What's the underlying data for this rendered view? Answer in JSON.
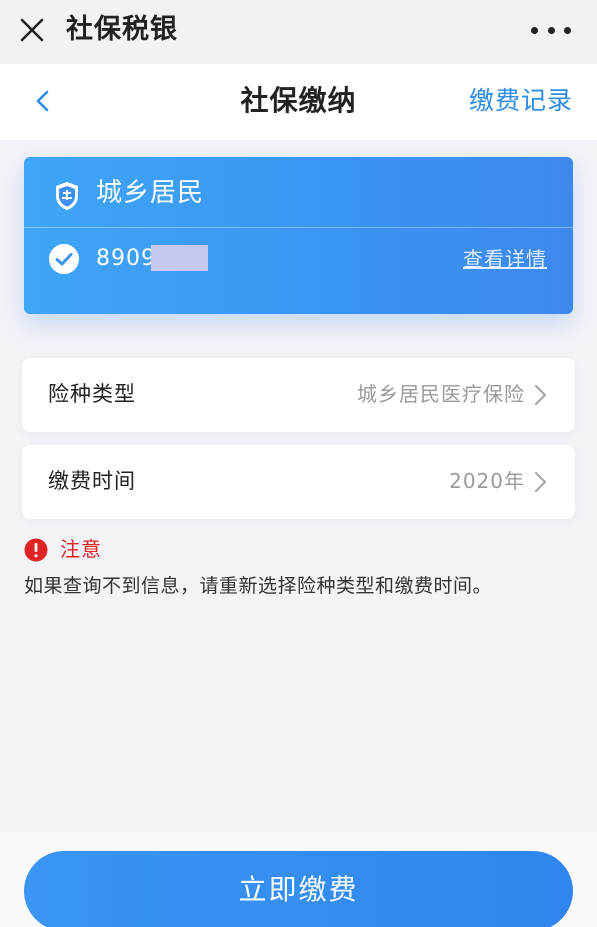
{
  "topbar": {
    "app_title": "社保税银",
    "close_icon": "close-icon",
    "more_icon": "more-icon"
  },
  "navbar": {
    "title": "社保缴纳",
    "records_link": "缴费记录",
    "back_icon": "chevron-left-icon"
  },
  "card": {
    "title": "城乡居民",
    "account_prefix": "8909",
    "details_link": "查看详情",
    "badge_icon": "shield-badge-icon",
    "check_icon": "check-circle-icon"
  },
  "form": {
    "insurance_type": {
      "label": "险种类型",
      "value": "城乡居民医疗保险"
    },
    "payment_time": {
      "label": "缴费时间",
      "value": "2020年"
    }
  },
  "notice": {
    "title": "注意",
    "text": "如果查询不到信息，请重新选择险种类型和缴费时间。",
    "icon": "alert-circle-icon"
  },
  "actions": {
    "pay_now": "立即缴费"
  },
  "colors": {
    "accent": "#2d8de8",
    "card_blue": "#3a95f2",
    "warning_red": "#e02424",
    "background": "#f4f3f8"
  }
}
